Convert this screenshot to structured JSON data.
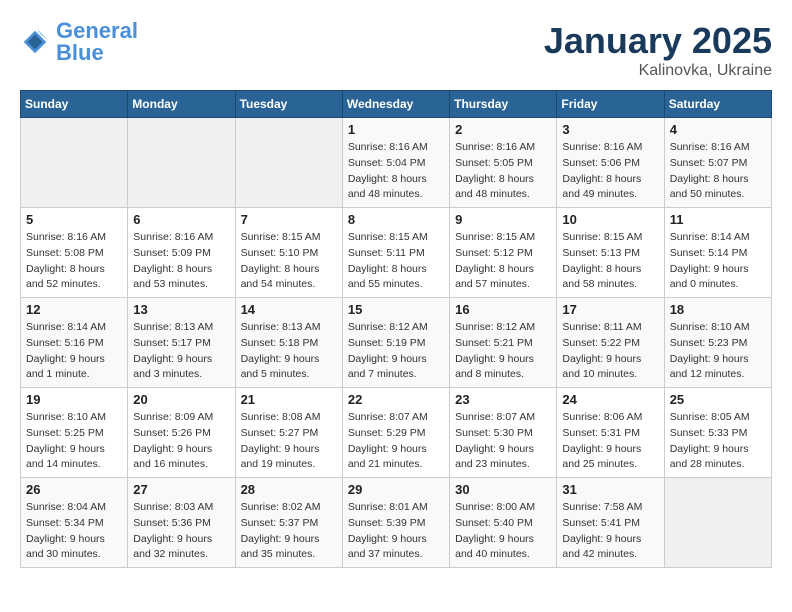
{
  "header": {
    "logo_line1": "General",
    "logo_line2": "Blue",
    "month": "January 2025",
    "location": "Kalinovka, Ukraine"
  },
  "weekdays": [
    "Sunday",
    "Monday",
    "Tuesday",
    "Wednesday",
    "Thursday",
    "Friday",
    "Saturday"
  ],
  "weeks": [
    [
      {
        "day": "",
        "info": ""
      },
      {
        "day": "",
        "info": ""
      },
      {
        "day": "",
        "info": ""
      },
      {
        "day": "1",
        "info": "Sunrise: 8:16 AM\nSunset: 5:04 PM\nDaylight: 8 hours\nand 48 minutes."
      },
      {
        "day": "2",
        "info": "Sunrise: 8:16 AM\nSunset: 5:05 PM\nDaylight: 8 hours\nand 48 minutes."
      },
      {
        "day": "3",
        "info": "Sunrise: 8:16 AM\nSunset: 5:06 PM\nDaylight: 8 hours\nand 49 minutes."
      },
      {
        "day": "4",
        "info": "Sunrise: 8:16 AM\nSunset: 5:07 PM\nDaylight: 8 hours\nand 50 minutes."
      }
    ],
    [
      {
        "day": "5",
        "info": "Sunrise: 8:16 AM\nSunset: 5:08 PM\nDaylight: 8 hours\nand 52 minutes."
      },
      {
        "day": "6",
        "info": "Sunrise: 8:16 AM\nSunset: 5:09 PM\nDaylight: 8 hours\nand 53 minutes."
      },
      {
        "day": "7",
        "info": "Sunrise: 8:15 AM\nSunset: 5:10 PM\nDaylight: 8 hours\nand 54 minutes."
      },
      {
        "day": "8",
        "info": "Sunrise: 8:15 AM\nSunset: 5:11 PM\nDaylight: 8 hours\nand 55 minutes."
      },
      {
        "day": "9",
        "info": "Sunrise: 8:15 AM\nSunset: 5:12 PM\nDaylight: 8 hours\nand 57 minutes."
      },
      {
        "day": "10",
        "info": "Sunrise: 8:15 AM\nSunset: 5:13 PM\nDaylight: 8 hours\nand 58 minutes."
      },
      {
        "day": "11",
        "info": "Sunrise: 8:14 AM\nSunset: 5:14 PM\nDaylight: 9 hours\nand 0 minutes."
      }
    ],
    [
      {
        "day": "12",
        "info": "Sunrise: 8:14 AM\nSunset: 5:16 PM\nDaylight: 9 hours\nand 1 minute."
      },
      {
        "day": "13",
        "info": "Sunrise: 8:13 AM\nSunset: 5:17 PM\nDaylight: 9 hours\nand 3 minutes."
      },
      {
        "day": "14",
        "info": "Sunrise: 8:13 AM\nSunset: 5:18 PM\nDaylight: 9 hours\nand 5 minutes."
      },
      {
        "day": "15",
        "info": "Sunrise: 8:12 AM\nSunset: 5:19 PM\nDaylight: 9 hours\nand 7 minutes."
      },
      {
        "day": "16",
        "info": "Sunrise: 8:12 AM\nSunset: 5:21 PM\nDaylight: 9 hours\nand 8 minutes."
      },
      {
        "day": "17",
        "info": "Sunrise: 8:11 AM\nSunset: 5:22 PM\nDaylight: 9 hours\nand 10 minutes."
      },
      {
        "day": "18",
        "info": "Sunrise: 8:10 AM\nSunset: 5:23 PM\nDaylight: 9 hours\nand 12 minutes."
      }
    ],
    [
      {
        "day": "19",
        "info": "Sunrise: 8:10 AM\nSunset: 5:25 PM\nDaylight: 9 hours\nand 14 minutes."
      },
      {
        "day": "20",
        "info": "Sunrise: 8:09 AM\nSunset: 5:26 PM\nDaylight: 9 hours\nand 16 minutes."
      },
      {
        "day": "21",
        "info": "Sunrise: 8:08 AM\nSunset: 5:27 PM\nDaylight: 9 hours\nand 19 minutes."
      },
      {
        "day": "22",
        "info": "Sunrise: 8:07 AM\nSunset: 5:29 PM\nDaylight: 9 hours\nand 21 minutes."
      },
      {
        "day": "23",
        "info": "Sunrise: 8:07 AM\nSunset: 5:30 PM\nDaylight: 9 hours\nand 23 minutes."
      },
      {
        "day": "24",
        "info": "Sunrise: 8:06 AM\nSunset: 5:31 PM\nDaylight: 9 hours\nand 25 minutes."
      },
      {
        "day": "25",
        "info": "Sunrise: 8:05 AM\nSunset: 5:33 PM\nDaylight: 9 hours\nand 28 minutes."
      }
    ],
    [
      {
        "day": "26",
        "info": "Sunrise: 8:04 AM\nSunset: 5:34 PM\nDaylight: 9 hours\nand 30 minutes."
      },
      {
        "day": "27",
        "info": "Sunrise: 8:03 AM\nSunset: 5:36 PM\nDaylight: 9 hours\nand 32 minutes."
      },
      {
        "day": "28",
        "info": "Sunrise: 8:02 AM\nSunset: 5:37 PM\nDaylight: 9 hours\nand 35 minutes."
      },
      {
        "day": "29",
        "info": "Sunrise: 8:01 AM\nSunset: 5:39 PM\nDaylight: 9 hours\nand 37 minutes."
      },
      {
        "day": "30",
        "info": "Sunrise: 8:00 AM\nSunset: 5:40 PM\nDaylight: 9 hours\nand 40 minutes."
      },
      {
        "day": "31",
        "info": "Sunrise: 7:58 AM\nSunset: 5:41 PM\nDaylight: 9 hours\nand 42 minutes."
      },
      {
        "day": "",
        "info": ""
      }
    ]
  ]
}
